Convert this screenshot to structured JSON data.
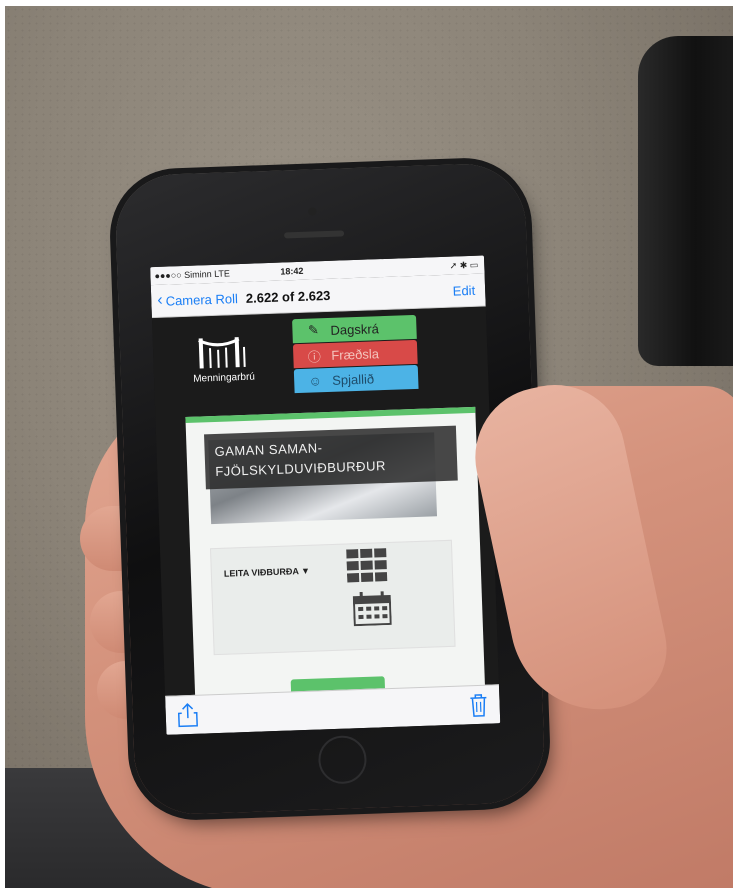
{
  "statusbar": {
    "carrier": "●●●○○ Siminn  LTE",
    "time": "18:42",
    "indicators": "➚ ✱ ▭"
  },
  "navbar": {
    "back_label": "Camera Roll",
    "title": "2.622 of 2.623",
    "edit_label": "Edit"
  },
  "app": {
    "logo_text": "Menningarbrú",
    "menu": [
      {
        "label": "Dagskrá",
        "icon": "pencil-icon",
        "color": "#5cc26b"
      },
      {
        "label": "Fræðsla",
        "icon": "info-icon",
        "color": "#d84a48"
      },
      {
        "label": "Spjallið",
        "icon": "chat-icon",
        "color": "#4cb3e6"
      }
    ],
    "hero_title_line1": "GAMAN SAMAN-",
    "hero_title_line2": "FJÖLSKYLDUVIÐBURÐUR",
    "search_label": "LEITA VIÐBURÐA"
  },
  "toolbar": {
    "share_icon": "share-icon",
    "trash_icon": "trash-icon"
  }
}
